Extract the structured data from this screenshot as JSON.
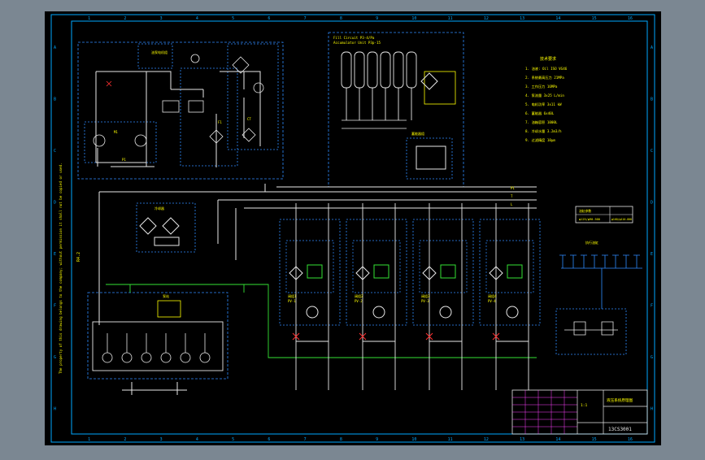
{
  "colors": {
    "background": "#7b8792",
    "sheet": "#000000",
    "frame": "#00a8ff",
    "line_blue": "#2f8cff",
    "line_white": "#e8e8e8",
    "line_green": "#34e234",
    "text_yellow": "#ffff00",
    "text_magenta": "#ff40ff",
    "accent_red": "#ff3030"
  },
  "frame": {
    "columns": [
      "1",
      "2",
      "3",
      "4",
      "5",
      "6",
      "7",
      "8",
      "9",
      "10",
      "11",
      "12",
      "13",
      "14",
      "15",
      "16"
    ],
    "rows": [
      "A",
      "B",
      "C",
      "D",
      "E",
      "F",
      "G",
      "H"
    ]
  },
  "labels": {
    "header_tank": "Fill Circuit   P3-4/Pa",
    "header_tank_sub": "Accumulator Unit  P3p-15",
    "notes_title": "技术要求",
    "notes": [
      "1. 油液: Oil ISO VG46",
      "2. 系统最高压力 21MPa",
      "3. 工作压力 16MPa",
      "4. 泵流量 3x25 L/min",
      "5. 电机功率 3x11 kW",
      "6. 蓄能器 6x40L",
      "7. 油箱容积 1000L",
      "8. 冷却水量 3.2m3/h",
      "9. 过滤精度 10μm"
    ],
    "main_p": "P1",
    "main_t": "T",
    "main_l": "L",
    "pump_unit": "泵站",
    "cooler": "冷却器",
    "circuit_labels": [
      "阀组1",
      "阀组2",
      "阀组3",
      "阀组4"
    ],
    "circuit_codes": [
      "PV-1",
      "PV-2",
      "PV-3",
      "PV-4"
    ],
    "side_table_title": "油缸参数",
    "side_table_rows": [
      "φ125/φ90-500",
      "φ160/φ110-800"
    ],
    "cylinder_group_title": "执行油缸",
    "accum_title": "蓄能器组",
    "vertical_note": "The property of this drawing belongs to the company; without permission it shall not be copied or used.",
    "title_block_company": "液压系统原理图",
    "title_block_drawing_no": "13CS3001",
    "title_block_scale": "1:1",
    "side_code": "R4.2"
  }
}
